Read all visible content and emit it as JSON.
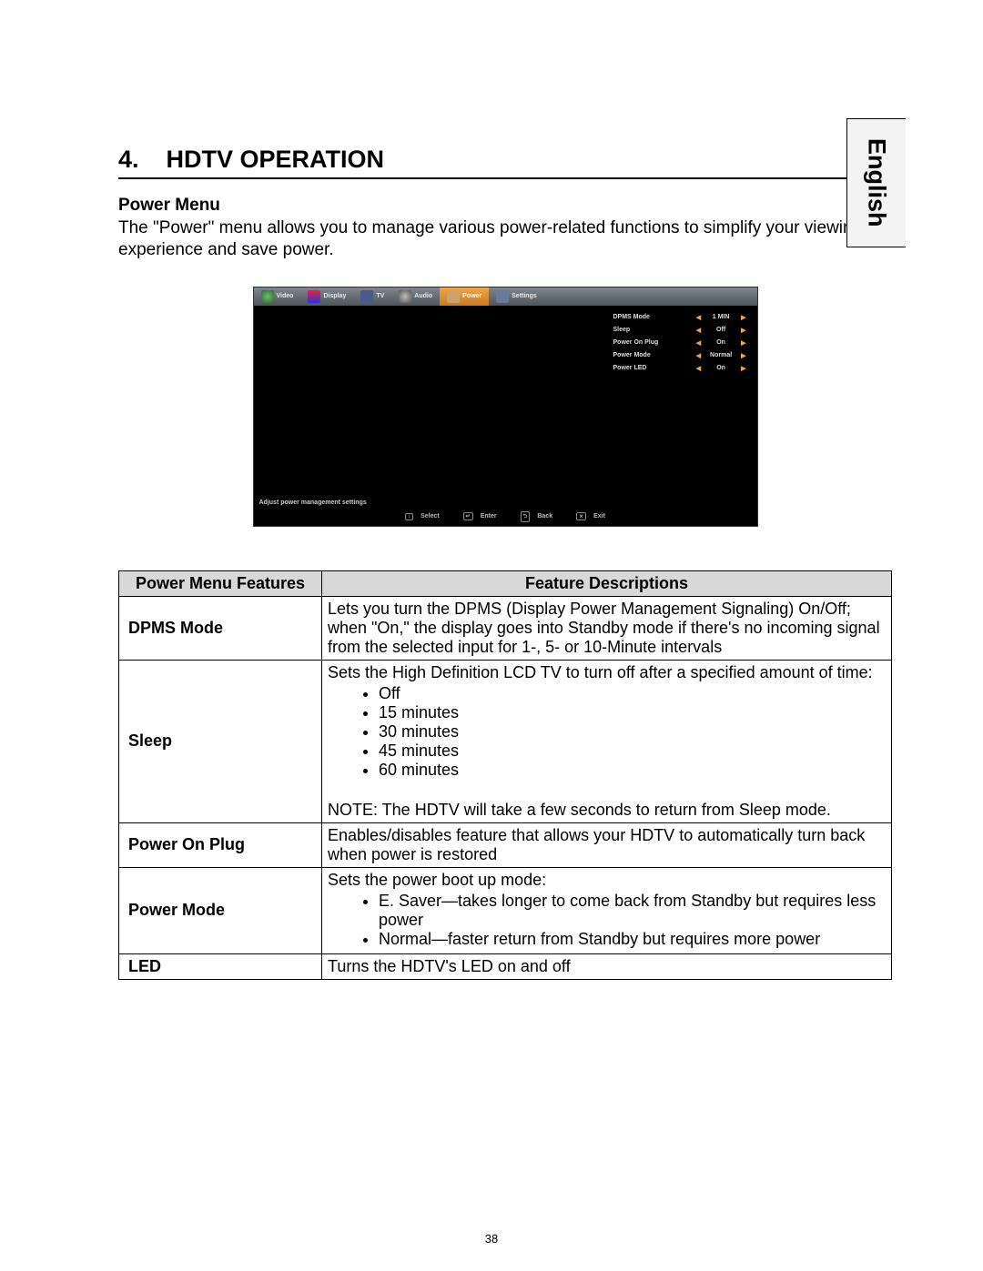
{
  "language_tab": "English",
  "heading_number": "4.",
  "heading_title": "HDTV OPERATION",
  "subheading": "Power Menu",
  "intro": "The \"Power\" menu allows you to manage various power-related functions to simplify your viewing experience and save power.",
  "osd": {
    "tabs": [
      "Video",
      "Display",
      "TV",
      "Audio",
      "Power",
      "Settings"
    ],
    "active_tab": "Power",
    "rows": [
      {
        "label": "DPMS Mode",
        "value": "1 MIN"
      },
      {
        "label": "Sleep",
        "value": "Off"
      },
      {
        "label": "Power On Plug",
        "value": "On"
      },
      {
        "label": "Power Mode",
        "value": "Normal"
      },
      {
        "label": "Power LED",
        "value": "On"
      }
    ],
    "hint": "Adjust power management settings",
    "footer": [
      "Select",
      "Enter",
      "Back",
      "Exit"
    ]
  },
  "table": {
    "header_feature": "Power Menu Features",
    "header_desc": "Feature Descriptions",
    "rows": {
      "dpms": {
        "name": "DPMS Mode",
        "desc": "Lets you turn the DPMS (Display Power Management Signaling) On/Off; when \"On,\" the display goes into Standby mode if there's no incoming signal from the selected input for 1-, 5- or 10-Minute intervals"
      },
      "sleep": {
        "name": "Sleep",
        "desc_lead": "Sets the High Definition LCD TV to turn off after a specified amount of time:",
        "options": [
          "Off",
          "15 minutes",
          "30 minutes",
          "45 minutes",
          "60 minutes"
        ],
        "note": "NOTE: The HDTV will take a few seconds to return from Sleep mode."
      },
      "plug": {
        "name": "Power On Plug",
        "desc": "Enables/disables feature that allows your HDTV to automatically turn back when power is restored"
      },
      "mode": {
        "name": "Power Mode",
        "desc_lead": "Sets the power boot up mode:",
        "options": [
          "E. Saver—takes longer to come back from Standby but requires less power",
          "Normal—faster return from Standby but requires more power"
        ]
      },
      "led": {
        "name": "LED",
        "desc": "Turns the HDTV's LED on and off"
      }
    }
  },
  "page_number": "38"
}
